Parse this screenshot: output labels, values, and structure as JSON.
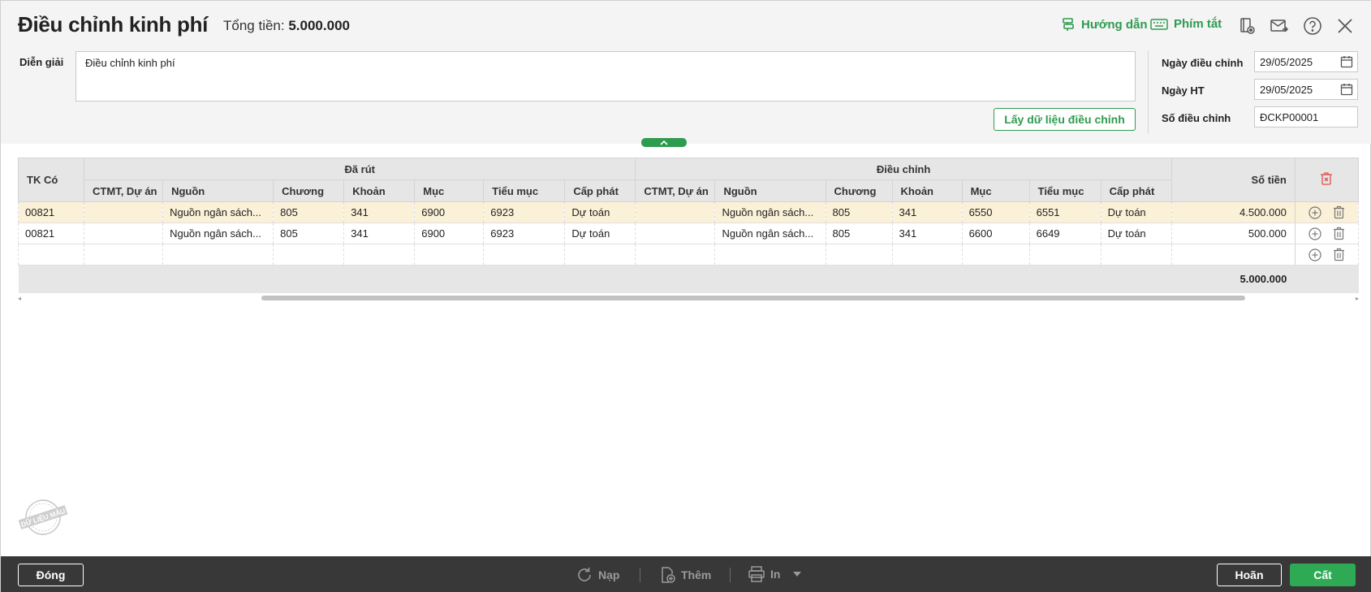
{
  "header": {
    "title": "Điều chỉnh kinh phí",
    "total_label": "Tổng tiền:",
    "total_value": "5.000.000",
    "guide_label": "Hướng dẫn",
    "shortcut_label": "Phím tắt"
  },
  "form": {
    "desc_label": "Diễn giải",
    "desc_value": "Điều chỉnh kinh phí",
    "fetch_button": "Lấy dữ liệu điều chỉnh",
    "adjust_date_label": "Ngày điều chỉnh",
    "adjust_date_value": "29/05/2025",
    "ht_date_label": "Ngày HT",
    "ht_date_value": "29/05/2025",
    "adjust_no_label": "Số điều chỉnh",
    "adjust_no_value": "ĐCKP00001"
  },
  "table": {
    "tk_co": "TK Có",
    "group_withdrawn": "Đã rút",
    "group_adjust": "Điều chỉnh",
    "amount": "Số tiền",
    "sub_columns": [
      "CTMT, Dự án",
      "Nguồn",
      "Chương",
      "Khoản",
      "Mục",
      "Tiểu mục",
      "Cấp phát"
    ],
    "rows": [
      [
        "00821",
        "",
        "Nguồn ngân sách...",
        "805",
        "341",
        "6900",
        "6923",
        "Dự toán",
        "",
        "Nguồn ngân sách...",
        "805",
        "341",
        "6550",
        "6551",
        "Dự toán",
        "4.500.000"
      ],
      [
        "00821",
        "",
        "Nguồn ngân sách...",
        "805",
        "341",
        "6900",
        "6923",
        "Dự toán",
        "",
        "Nguồn ngân sách...",
        "805",
        "341",
        "6600",
        "6649",
        "Dự toán",
        "500.000"
      ]
    ],
    "footer_total": "5.000.000"
  },
  "stamp_text": "DỮ LIỆU MẪU",
  "footer": {
    "close": "Đóng",
    "reload": "Nạp",
    "add": "Thêm",
    "print": "In",
    "cancel": "Hoãn",
    "save": "Cất"
  },
  "colors": {
    "accent": "#2e9b4f",
    "selected_row": "#fbf1d8",
    "footer_bg": "#383838"
  }
}
